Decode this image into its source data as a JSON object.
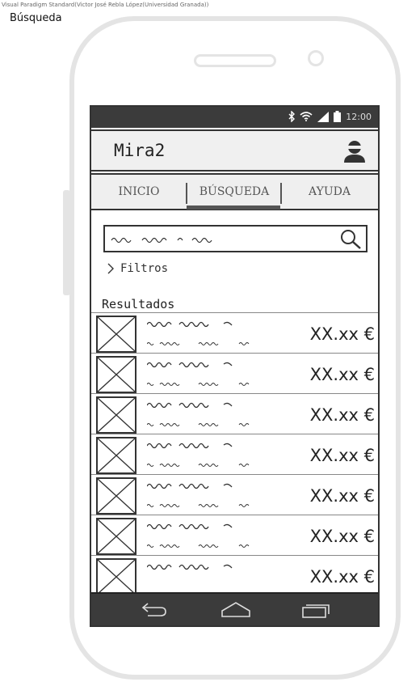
{
  "credit": "Visual Paradigm Standard(Victor José Rebla López(Universidad Granada))",
  "page_label": "Búsqueda",
  "status": {
    "time": "12:00"
  },
  "app": {
    "title": "Mira2"
  },
  "tabs": [
    {
      "label": "INICIO"
    },
    {
      "label": "BÚSQUEDA",
      "active": true
    },
    {
      "label": "AYUDA"
    }
  ],
  "filters": {
    "label": "Filtros"
  },
  "results": {
    "title": "Resultados",
    "items": [
      {
        "price": "XX.xx €"
      },
      {
        "price": "XX.xx €"
      },
      {
        "price": "XX.xx €"
      },
      {
        "price": "XX.xx €"
      },
      {
        "price": "XX.xx €"
      },
      {
        "price": "XX.xx €"
      },
      {
        "price": "XX.xx €"
      }
    ]
  },
  "colors": {
    "bar": "#3b3b3b",
    "tabbar": "#efefef",
    "frame": "#e4e4e4"
  }
}
